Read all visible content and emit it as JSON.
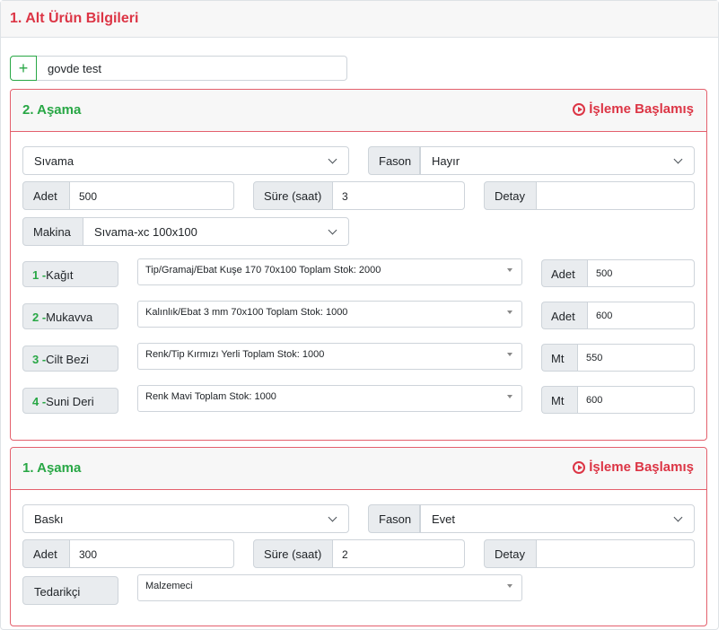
{
  "section": {
    "title": "1. Alt Ürün Bilgileri"
  },
  "subproduct": {
    "add_label": "+",
    "name": "govde test"
  },
  "stages": [
    {
      "title": "2. Aşama",
      "status": "İşleme Başlamış",
      "process": "Sıvama",
      "fason_label": "Fason",
      "fason_value": "Hayır",
      "adet_label": "Adet",
      "adet_value": "500",
      "sure_label": "Süre (saat)",
      "sure_value": "3",
      "detay_label": "Detay",
      "detay_value": "",
      "makina_label": "Makina",
      "makina_value": "Sıvama-xc 100x100",
      "materials": [
        {
          "idx": "1 -",
          "name": "Kağıt",
          "desc": "Tip/Gramaj/Ebat Kuşe 170 70x100 Toplam Stok: 2000",
          "unit": "Adet",
          "qty": "500"
        },
        {
          "idx": "2 -",
          "name": "Mukavva",
          "desc": "Kalınlık/Ebat 3 mm 70x100 Toplam Stok: 1000",
          "unit": "Adet",
          "qty": "600"
        },
        {
          "idx": "3 -",
          "name": "Cilt Bezi",
          "desc": "Renk/Tip Kırmızı Yerli Toplam Stok: 1000",
          "unit": "Mt",
          "qty": "550"
        },
        {
          "idx": "4 -",
          "name": "Suni Deri",
          "desc": "Renk Mavi Toplam Stok: 1000",
          "unit": "Mt",
          "qty": "600"
        }
      ]
    },
    {
      "title": "1. Aşama",
      "status": "İşleme Başlamış",
      "process": "Baskı",
      "fason_label": "Fason",
      "fason_value": "Evet",
      "adet_label": "Adet",
      "adet_value": "300",
      "sure_label": "Süre (saat)",
      "sure_value": "2",
      "detay_label": "Detay",
      "detay_value": "",
      "tedarikci_label": "Tedarikçi",
      "tedarikci_value": "Malzemeci"
    }
  ]
}
